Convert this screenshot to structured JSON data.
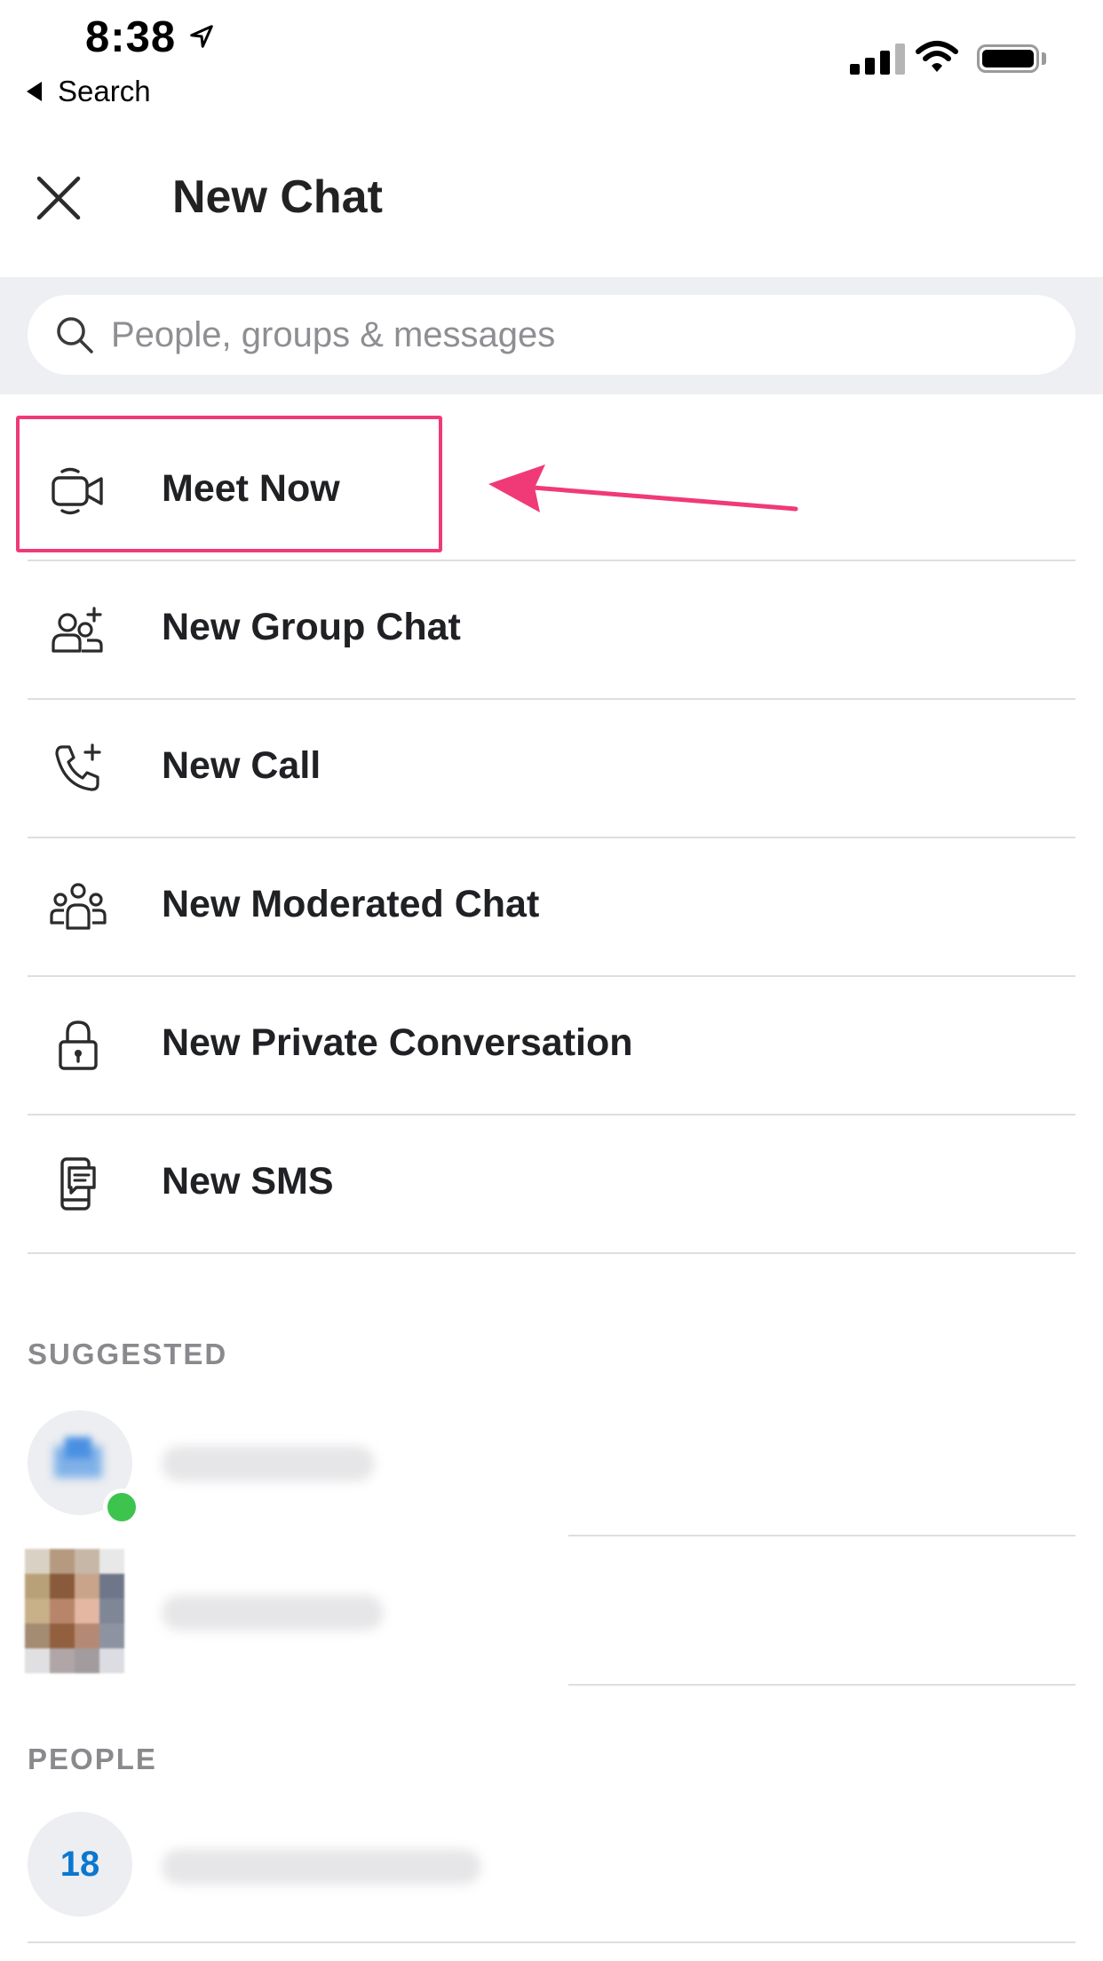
{
  "status_bar": {
    "time": "8:38",
    "back_label": "Search",
    "icons": [
      "location-arrow-icon",
      "cellular-signal-icon",
      "wifi-icon",
      "battery-icon"
    ]
  },
  "header": {
    "title": "New Chat",
    "close_icon": "close-icon"
  },
  "search": {
    "placeholder": "People, groups & messages",
    "icon": "search-icon"
  },
  "actions": [
    {
      "label": "Meet Now",
      "icon": "video-camera-icon"
    },
    {
      "label": "New Group Chat",
      "icon": "group-add-icon"
    },
    {
      "label": "New Call",
      "icon": "phone-add-icon"
    },
    {
      "label": "New Moderated Chat",
      "icon": "people-group-icon"
    },
    {
      "label": "New Private Conversation",
      "icon": "lock-icon"
    },
    {
      "label": "New SMS",
      "icon": "sms-phone-icon"
    }
  ],
  "sections": {
    "suggested": "SUGGESTED",
    "people": "PEOPLE"
  },
  "people": {
    "first_avatar_initials": "18"
  },
  "colors": {
    "highlight": "#f03a78",
    "accent_blue": "#0b77d0",
    "presence_green": "#3cc44f",
    "search_band": "#eeeff2"
  }
}
